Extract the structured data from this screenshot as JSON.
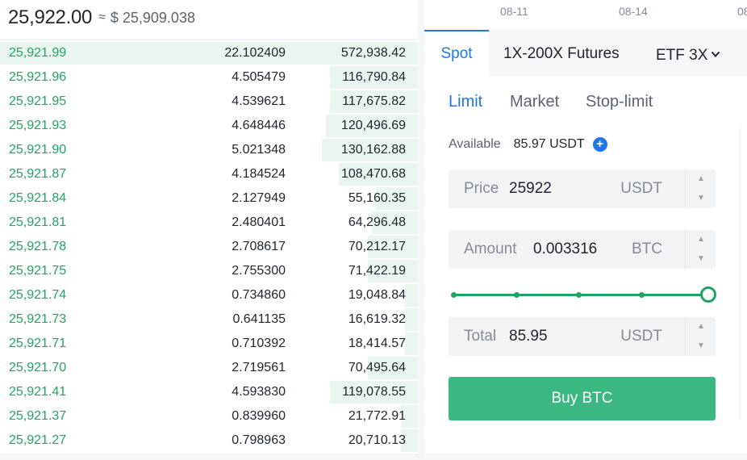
{
  "header": {
    "last_price": "25,922.00",
    "approx_symbol": "≈",
    "fiat_price": "$ 25,909.038"
  },
  "order_book": {
    "rows": [
      {
        "price": "25,921.99",
        "amount": "22.102409",
        "total": "572,938.42",
        "depth": 1.0
      },
      {
        "price": "25,921.96",
        "amount": "4.505479",
        "total": "116,790.84",
        "depth": 0.21
      },
      {
        "price": "25,921.95",
        "amount": "4.539621",
        "total": "117,675.82",
        "depth": 0.21
      },
      {
        "price": "25,921.93",
        "amount": "4.648446",
        "total": "120,496.69",
        "depth": 0.22
      },
      {
        "price": "25,921.90",
        "amount": "5.021348",
        "total": "130,162.88",
        "depth": 0.23
      },
      {
        "price": "25,921.87",
        "amount": "4.184524",
        "total": "108,470.68",
        "depth": 0.19
      },
      {
        "price": "25,921.84",
        "amount": "2.127949",
        "total": "55,160.35",
        "depth": 0.1
      },
      {
        "price": "25,921.81",
        "amount": "2.480401",
        "total": "64,296.48",
        "depth": 0.11
      },
      {
        "price": "25,921.78",
        "amount": "2.708617",
        "total": "70,212.17",
        "depth": 0.12
      },
      {
        "price": "25,921.75",
        "amount": "2.755300",
        "total": "71,422.19",
        "depth": 0.12
      },
      {
        "price": "25,921.74",
        "amount": "0.734860",
        "total": "19,048.84",
        "depth": 0.03
      },
      {
        "price": "25,921.73",
        "amount": "0.641135",
        "total": "16,619.32",
        "depth": 0.03
      },
      {
        "price": "25,921.71",
        "amount": "0.710392",
        "total": "18,414.57",
        "depth": 0.03
      },
      {
        "price": "25,921.70",
        "amount": "2.719561",
        "total": "70,495.64",
        "depth": 0.12
      },
      {
        "price": "25,921.41",
        "amount": "4.593830",
        "total": "119,078.55",
        "depth": 0.21
      },
      {
        "price": "25,921.37",
        "amount": "0.839960",
        "total": "21,772.91",
        "depth": 0.04
      },
      {
        "price": "25,921.27",
        "amount": "0.798963",
        "total": "20,710.13",
        "depth": 0.04
      }
    ]
  },
  "chart_axis": {
    "dates": [
      "08-11",
      "08-14",
      "08"
    ]
  },
  "tabs": {
    "spot": "Spot",
    "futures": "1X-200X Futures",
    "etf": "ETF 3X"
  },
  "order_types": {
    "limit": "Limit",
    "market": "Market",
    "stop_limit": "Stop-limit"
  },
  "available": {
    "label": "Available",
    "value": "85.97 USDT"
  },
  "price_field": {
    "label": "Price",
    "value": "25922",
    "unit": "USDT"
  },
  "amount_field": {
    "label": "Amount",
    "value": "0.003316",
    "unit": "BTC"
  },
  "slider": {
    "percent": 100,
    "marks": [
      0,
      25,
      50,
      75,
      100
    ]
  },
  "total_field": {
    "label": "Total",
    "value": "85.95",
    "unit": "USDT"
  },
  "buy_button": {
    "label": "Buy BTC"
  },
  "colors": {
    "buy_green": "#20a465",
    "button_green": "#3bb881",
    "depth_bar": "#e8f6ef",
    "accent_blue": "#1e77e5"
  },
  "icons": {
    "plus": "plus-circle-icon",
    "chevron": "chevron-down-icon",
    "step_up": "caret-up-icon",
    "step_down": "caret-down-icon"
  }
}
